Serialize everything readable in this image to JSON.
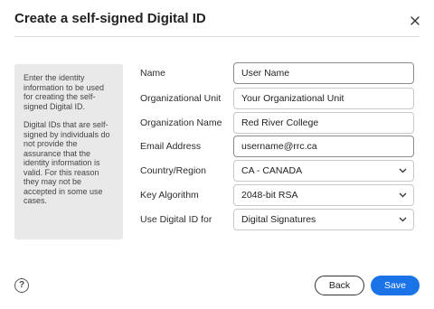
{
  "dialog": {
    "title": "Create a self-signed Digital ID"
  },
  "sidebar": {
    "paragraph1": "Enter the identity information to be used for creating the self-signed Digital ID.",
    "paragraph2": "Digital IDs that are self-signed by individuals do not provide the assurance that the identity information is valid. For this reason they may not be accepted in some use cases."
  },
  "form": {
    "name": {
      "label": "Name",
      "value": "User Name"
    },
    "org_unit": {
      "label": "Organizational Unit",
      "value": "Your Organizational Unit"
    },
    "org_name": {
      "label": "Organization Name",
      "value": "Red River College"
    },
    "email": {
      "label": "Email Address",
      "value": "username@rrc.ca"
    },
    "country": {
      "label": "Country/Region",
      "value": "CA - CANADA"
    },
    "key_algorithm": {
      "label": "Key Algorithm",
      "value": "2048-bit RSA"
    },
    "use_for": {
      "label": "Use Digital ID for",
      "value": "Digital Signatures"
    }
  },
  "footer": {
    "help": "?",
    "back_label": "Back",
    "save_label": "Save"
  },
  "colors": {
    "primary": "#1b73e8",
    "sidebar_bg": "#e9e9e9"
  }
}
